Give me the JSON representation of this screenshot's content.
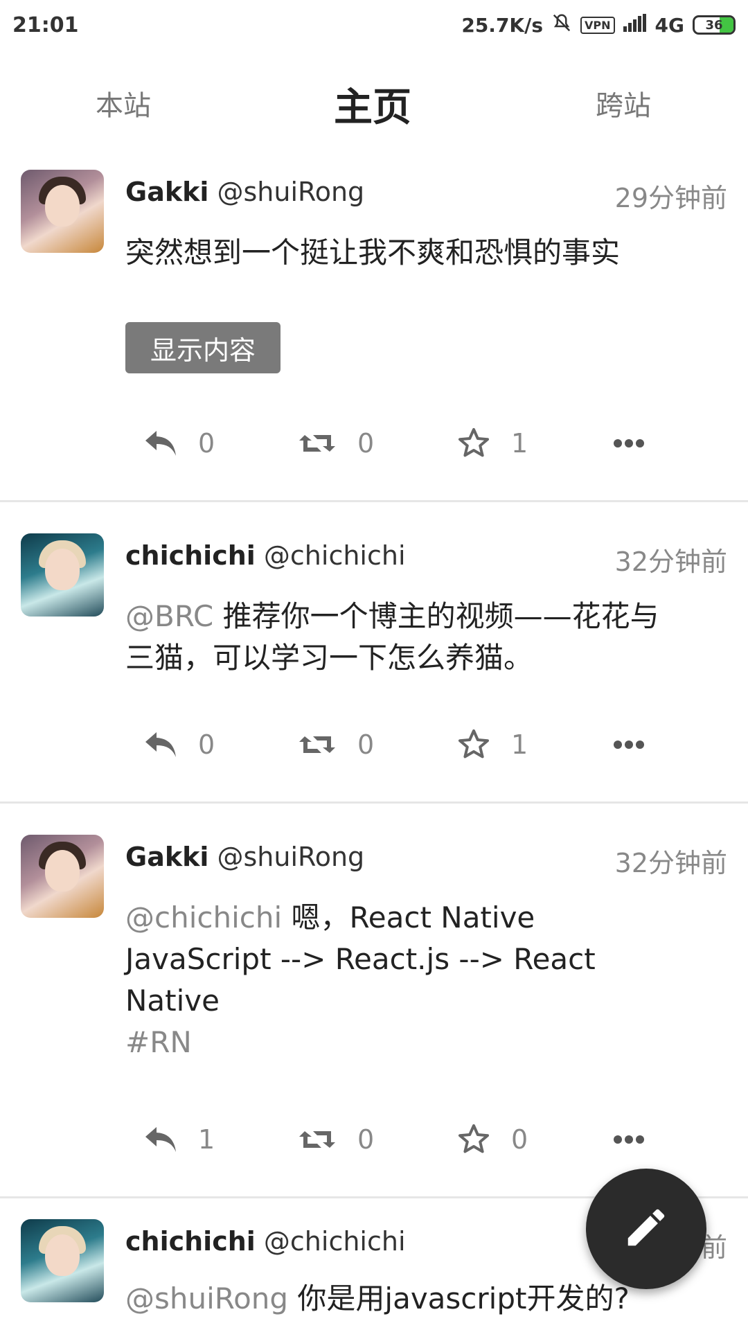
{
  "status_bar": {
    "time": "21:01",
    "speed": "25.7K/s",
    "vpn": "VPN",
    "network": "4G",
    "battery": "36"
  },
  "tabs": {
    "left": "本站",
    "active": "主页",
    "right": "跨站"
  },
  "posts": [
    {
      "display_name": "Gakki",
      "handle": "@shuiRong",
      "time": "29分钟前",
      "content": "突然想到一个挺让我不爽和恐惧的事实",
      "show_button": "显示内容",
      "replies": "0",
      "boosts": "0",
      "favs": "1"
    },
    {
      "display_name": "chichichi",
      "handle": "@chichichi",
      "time": "32分钟前",
      "mention": "@BRC",
      "content": " 推荐你一个博主的视频——花花与三猫，可以学习一下怎么养猫。",
      "replies": "0",
      "boosts": "0",
      "favs": "1"
    },
    {
      "display_name": "Gakki",
      "handle": "@shuiRong",
      "time": "32分钟前",
      "mention": "@chichichi",
      "content_line1": " 嗯，React Native",
      "content_line2": "JavaScript --> React.js --> React",
      "content_line3": "Native",
      "hashtag": "#RN",
      "replies": "1",
      "boosts": "0",
      "favs": "0"
    },
    {
      "display_name": "chichichi",
      "handle": "@chichichi",
      "time": "前",
      "mention": "@shuiRong",
      "content": " 你是用javascript开发的?"
    }
  ],
  "icons": {
    "reply": "reply-icon",
    "boost": "boost-icon",
    "fav": "star-icon",
    "more": "more-icon",
    "compose": "pencil-icon"
  }
}
